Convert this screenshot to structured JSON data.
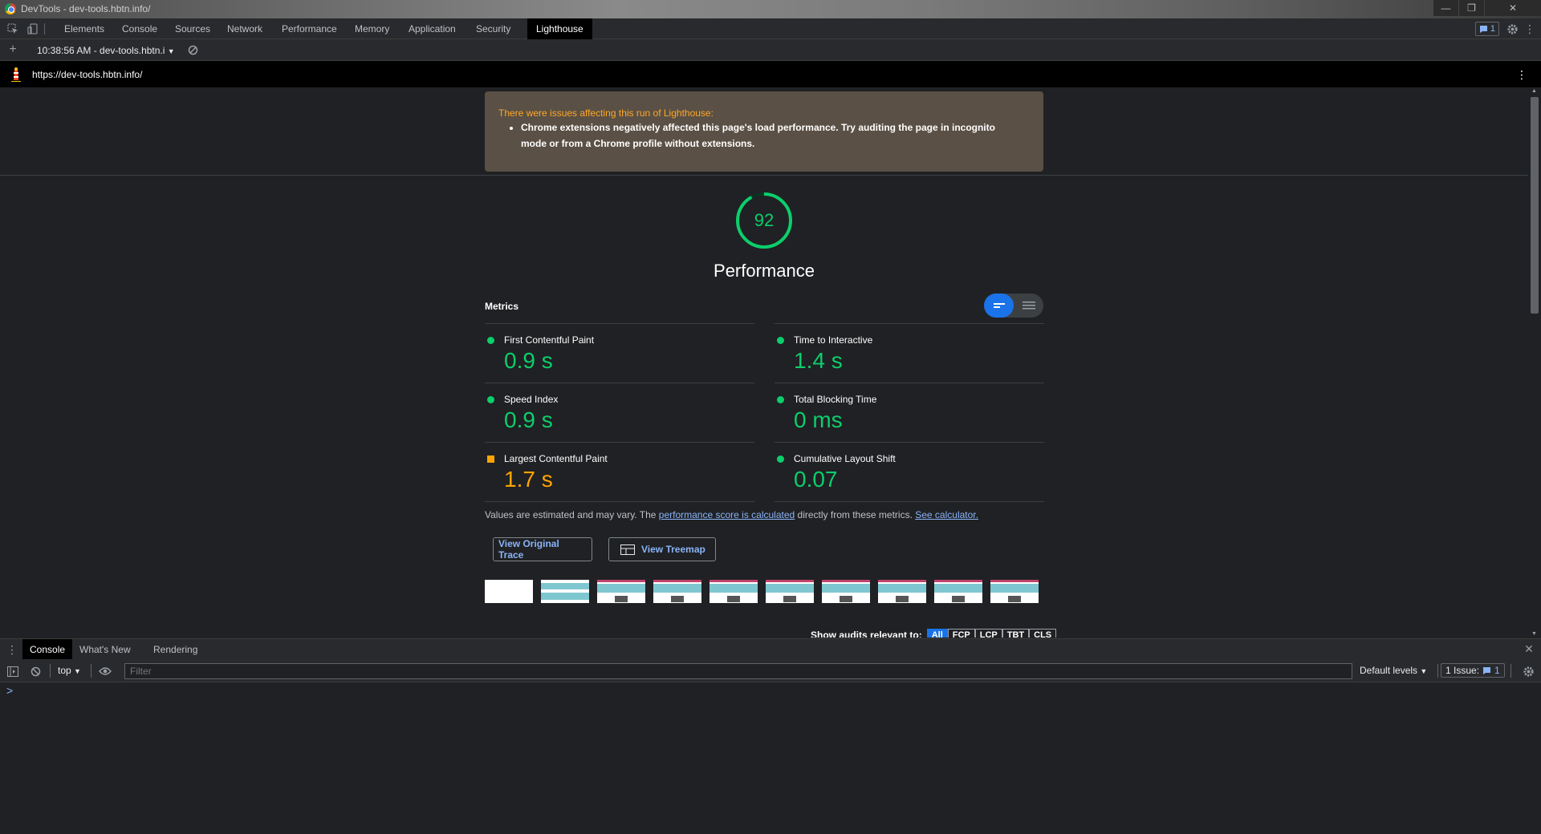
{
  "window": {
    "title": "DevTools - dev-tools.hbtn.info/"
  },
  "main_tabs": [
    "Elements",
    "Console",
    "Sources",
    "Network",
    "Performance",
    "Memory",
    "Application",
    "Security",
    "Lighthouse"
  ],
  "issues_count": "1",
  "lighthouse_toolbar": {
    "report_label": "10:38:56 AM - dev-tools.hbtn.i"
  },
  "url": "https://dev-tools.hbtn.info/",
  "warning": {
    "heading": "There were issues affecting this run of Lighthouse:",
    "item": "Chrome extensions negatively affected this page's load performance. Try auditing the page in incognito mode or from a Chrome profile without extensions."
  },
  "performance": {
    "score": "92",
    "score_fraction": 0.92,
    "title": "Performance",
    "score_color": "#0cce6b"
  },
  "metrics": {
    "label": "Metrics",
    "left": [
      {
        "name": "First Contentful Paint",
        "value": "0.9 s",
        "status": "pass"
      },
      {
        "name": "Speed Index",
        "value": "0.9 s",
        "status": "pass"
      },
      {
        "name": "Largest Contentful Paint",
        "value": "1.7 s",
        "status": "average"
      }
    ],
    "right": [
      {
        "name": "Time to Interactive",
        "value": "1.4 s",
        "status": "pass"
      },
      {
        "name": "Total Blocking Time",
        "value": "0 ms",
        "status": "pass"
      },
      {
        "name": "Cumulative Layout Shift",
        "value": "0.07",
        "status": "pass"
      }
    ]
  },
  "colors": {
    "pass": "#0cce6b",
    "average": "#ffa400",
    "link": "#8ab4f8",
    "accent": "#1a73e8"
  },
  "note": {
    "prefix": "Values are estimated and may vary. The ",
    "link1": "performance score is calculated",
    "middle": " directly from these metrics. ",
    "link2": "See calculator."
  },
  "buttons": {
    "trace": "View Original Trace",
    "treemap": "View Treemap"
  },
  "audits_filter": {
    "label": "Show audits relevant to:",
    "chips": [
      "All",
      "FCP",
      "LCP",
      "TBT",
      "CLS"
    ]
  },
  "drawer": {
    "tabs": [
      "Console",
      "What's New",
      "Rendering"
    ],
    "context": "top",
    "filter_placeholder": "Filter",
    "levels": "Default levels",
    "issues_label": "1 Issue:",
    "issues_count": "1",
    "prompt": ">"
  }
}
